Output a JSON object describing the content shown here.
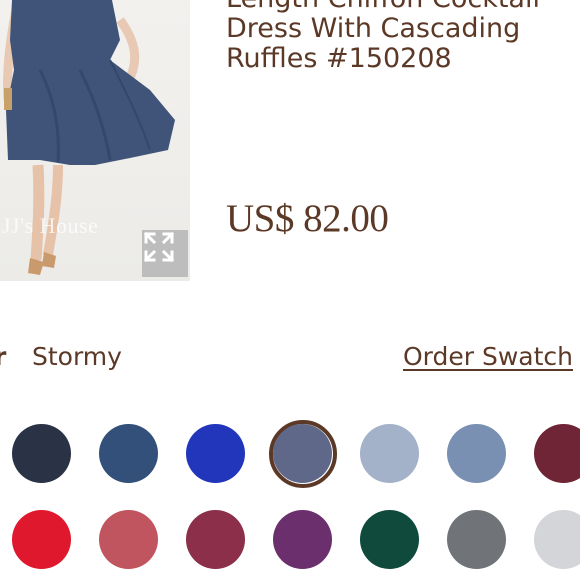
{
  "product": {
    "title_lines": [
      "Length Chiffon Cocktail",
      "Dress With Cascading",
      "Ruffles #150208"
    ],
    "price": "US$ 82.00",
    "watermark": "JJ's House"
  },
  "color_selector": {
    "label": "r",
    "selected_color": "Stormy",
    "order_swatch_link": "Order Swatch"
  },
  "swatches": [
    {
      "color": "#2a3346",
      "selected": false
    },
    {
      "color": "#33507a",
      "selected": false
    },
    {
      "color": "#2236bc",
      "selected": false
    },
    {
      "color": "#5f6889",
      "selected": true
    },
    {
      "color": "#a3b2c8",
      "selected": false
    },
    {
      "color": "#7a90b2",
      "selected": false
    },
    {
      "color": "#6f2535",
      "selected": false
    },
    {
      "color": "#e0182e",
      "selected": false
    },
    {
      "color": "#c05560",
      "selected": false
    },
    {
      "color": "#8b2f4a",
      "selected": false
    },
    {
      "color": "#6c2f6e",
      "selected": false
    },
    {
      "color": "#0f4a3d",
      "selected": false
    },
    {
      "color": "#707478",
      "selected": false
    },
    {
      "color": "#d4d5d8",
      "selected": false
    }
  ],
  "icons": {
    "expand": "expand-arrows-icon"
  }
}
